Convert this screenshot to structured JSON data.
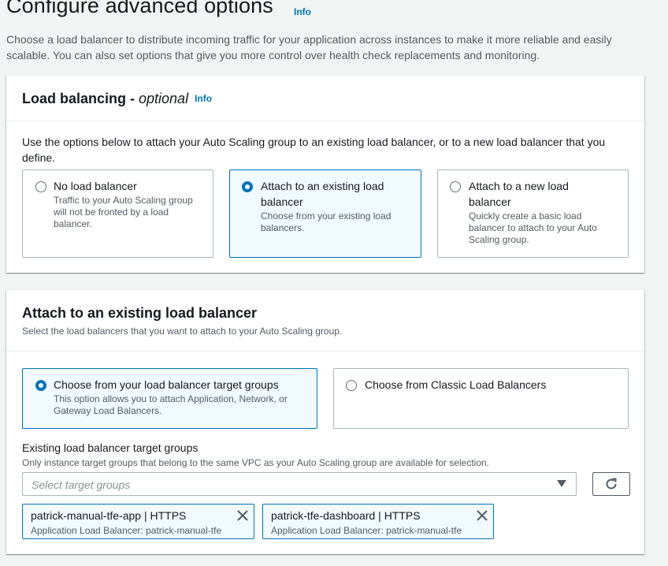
{
  "page": {
    "title": "Configure advanced options",
    "info": "Info",
    "description": "Choose a load balancer to distribute incoming traffic for your application across instances to make it more reliable and easily scalable. You can also set options that give you more control over health check replacements and monitoring."
  },
  "load_balancing": {
    "heading": "Load balancing - ",
    "heading_optional": "optional",
    "info": "Info",
    "description": "Use the options below to attach your Auto Scaling group to an existing load balancer, or to a new load balancer that you define.",
    "options": [
      {
        "label": "No load balancer",
        "desc": "Traffic to your Auto Scaling group will not be fronted by a load balancer.",
        "selected": false
      },
      {
        "label": "Attach to an existing load balancer",
        "desc": "Choose from your existing load balancers.",
        "selected": true
      },
      {
        "label": "Attach to a new load balancer",
        "desc": "Quickly create a basic load balancer to attach to your Auto Scaling group.",
        "selected": false
      }
    ]
  },
  "attach_existing": {
    "heading": "Attach to an existing load balancer",
    "subheading": "Select the load balancers that you want to attach to your Auto Scaling group.",
    "options": [
      {
        "label": "Choose from your load balancer target groups",
        "desc": "This option allows you to attach Application, Network, or Gateway Load Balancers.",
        "selected": true
      },
      {
        "label": "Choose from Classic Load Balancers",
        "desc": "",
        "selected": false
      }
    ],
    "field_label": "Existing load balancer target groups",
    "field_desc": "Only instance target groups that belong to the same VPC as your Auto Scaling group are available for selection.",
    "select_placeholder": "Select target groups",
    "tokens": [
      {
        "title": "patrick-manual-tfe-app | HTTPS",
        "sub": "Application Load Balancer: patrick-manual-tfe"
      },
      {
        "title": "patrick-tfe-dashboard | HTTPS",
        "sub": "Application Load Balancer: patrick-manual-tfe"
      }
    ]
  },
  "colors": {
    "accent": "#0073bb",
    "selected_bg": "#f1faff",
    "page_bg": "#f2f3f3"
  }
}
